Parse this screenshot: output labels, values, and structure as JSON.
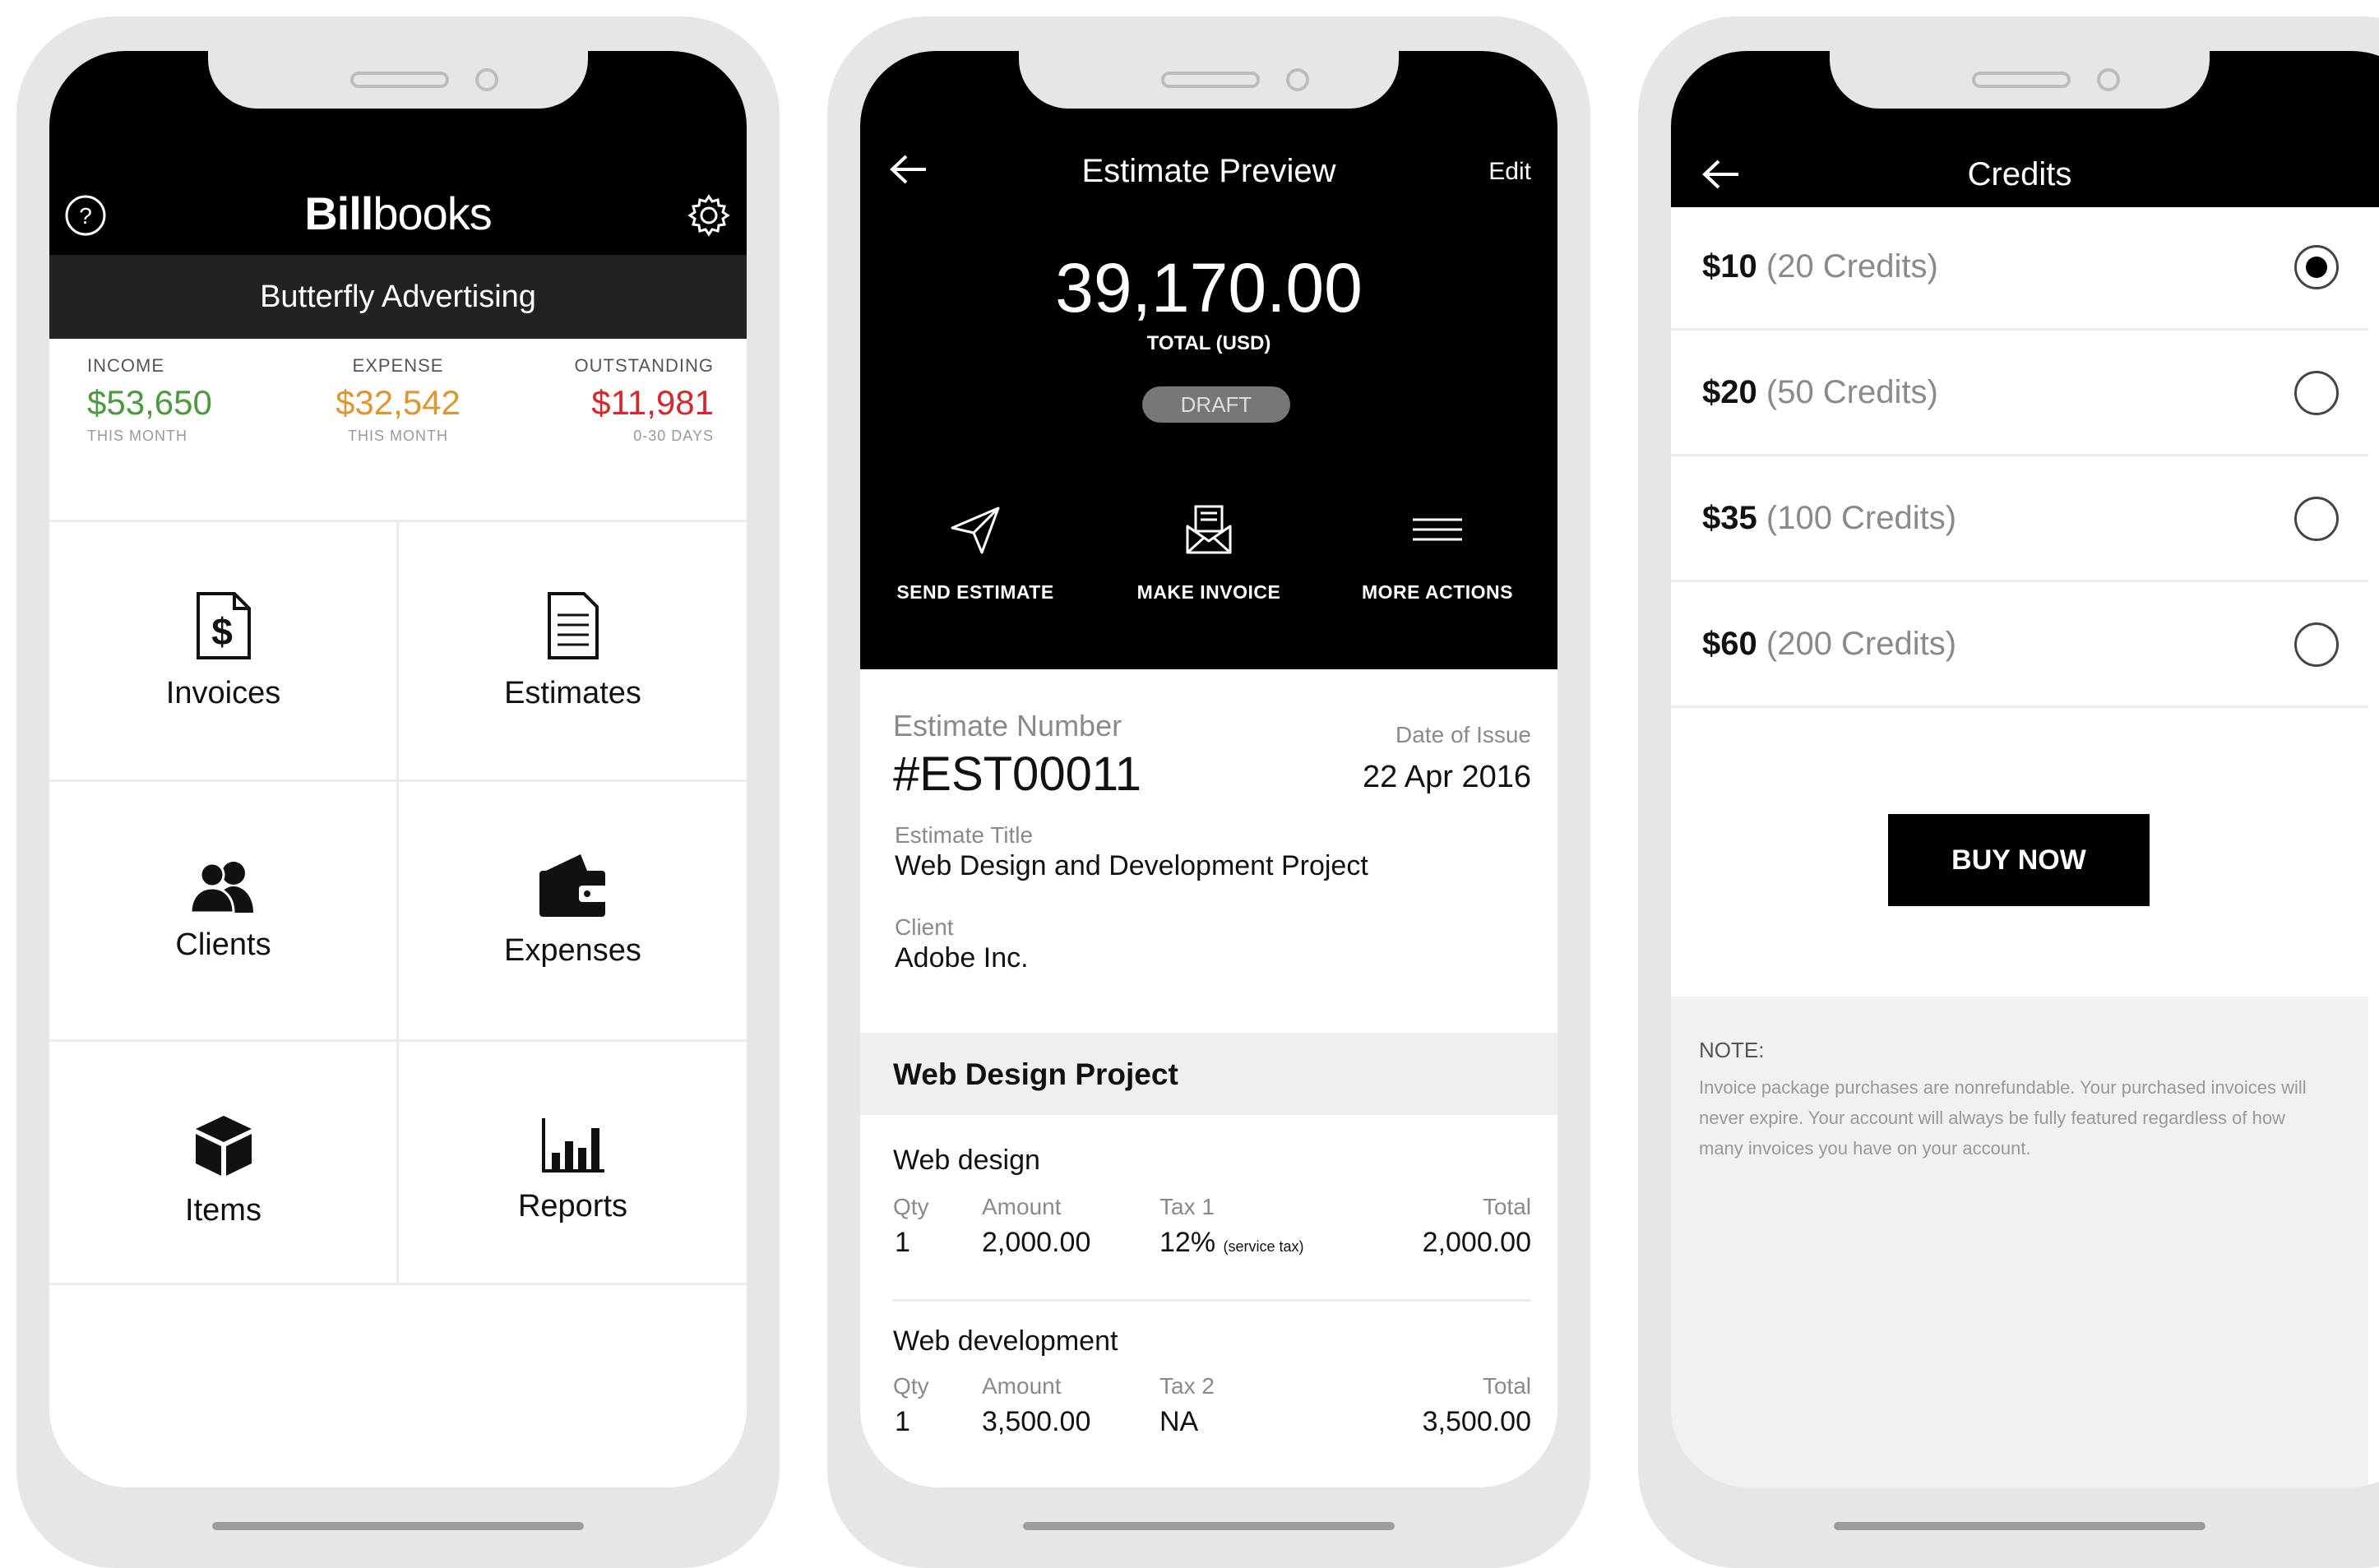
{
  "home": {
    "brand_bold": "Bill",
    "brand_regular": "books",
    "business_name": "Butterfly Advertising",
    "stats": [
      {
        "label": "INCOME",
        "value": "$53,650",
        "sub": "THIS MONTH",
        "color": "#4a9b3a"
      },
      {
        "label": "EXPENSE",
        "value": "$32,542",
        "sub": "THIS MONTH",
        "color": "#e0962f"
      },
      {
        "label": "OUTSTANDING",
        "value": "$11,981",
        "sub": "0-30 DAYS",
        "color": "#d9262b"
      }
    ],
    "tiles": [
      {
        "label": "Invoices",
        "icon": "invoice-dollar-icon"
      },
      {
        "label": "Estimates",
        "icon": "document-lines-icon"
      },
      {
        "label": "Clients",
        "icon": "users-icon"
      },
      {
        "label": "Expenses",
        "icon": "wallet-icon"
      },
      {
        "label": "Items",
        "icon": "box-icon"
      },
      {
        "label": "Reports",
        "icon": "bar-chart-icon"
      }
    ]
  },
  "estimate": {
    "title": "Estimate Preview",
    "edit_label": "Edit",
    "total": "39,170.00",
    "total_label": "TOTAL (USD)",
    "status": "DRAFT",
    "actions": [
      {
        "label": "SEND ESTIMATE",
        "icon": "paper-plane-icon"
      },
      {
        "label": "MAKE INVOICE",
        "icon": "envelope-invoice-icon"
      },
      {
        "label": "MORE ACTIONS",
        "icon": "menu-lines-icon"
      }
    ],
    "number_label": "Estimate Number",
    "number": "#EST00011",
    "date_label": "Date of Issue",
    "date": "22 Apr 2016",
    "est_title_label": "Estimate Title",
    "est_title": "Web Design and Development Project",
    "client_label": "Client",
    "client": "Adobe Inc.",
    "section": "Web Design Project",
    "items": [
      {
        "name": "Web design",
        "qty_label": "Qty",
        "qty": "1",
        "amount_label": "Amount",
        "amount": "2,000.00",
        "tax_label": "Tax 1",
        "tax": "12%",
        "tax_note": "(service tax)",
        "total_label": "Total",
        "total": "2,000.00"
      },
      {
        "name": "Web development",
        "qty_label": "Qty",
        "qty": "1",
        "amount_label": "Amount",
        "amount": "3,500.00",
        "tax_label": "Tax 2",
        "tax": "NA",
        "tax_note": "",
        "total_label": "Total",
        "total": "3,500.00"
      }
    ]
  },
  "credits": {
    "title": "Credits",
    "options": [
      {
        "price": "$10",
        "credits": "(20 Credits)",
        "selected": true
      },
      {
        "price": "$20",
        "credits": "(50 Credits)",
        "selected": false
      },
      {
        "price": "$35",
        "credits": "(100 Credits)",
        "selected": false
      },
      {
        "price": "$60",
        "credits": "(200 Credits)",
        "selected": false
      }
    ],
    "buy_label": "BUY NOW",
    "note_title": "NOTE:",
    "note_text": "Invoice package purchases are nonrefundable. Your purchased invoices will never expire. Your account will always be fully featured regardless of how many invoices you have on your account."
  }
}
